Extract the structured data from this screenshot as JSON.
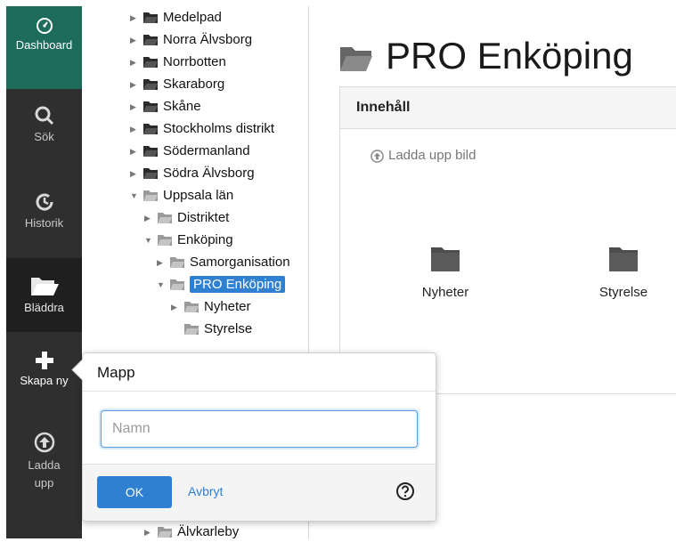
{
  "sidebar": {
    "items": [
      {
        "label": "Dashboard",
        "icon": "dashboard-gauge-icon"
      },
      {
        "label": "Sök",
        "icon": "search-icon"
      },
      {
        "label": "Historik",
        "icon": "history-icon"
      },
      {
        "label": "Bläddra",
        "icon": "folder-open-icon"
      },
      {
        "label": "Skapa ny",
        "icon": "plus-icon"
      },
      {
        "label": "Ladda upp",
        "icon": "upload-icon"
      }
    ]
  },
  "tree": {
    "nodes": [
      {
        "label": "Medelpad"
      },
      {
        "label": "Norra Älvsborg"
      },
      {
        "label": "Norrbotten"
      },
      {
        "label": "Skaraborg"
      },
      {
        "label": "Skåne"
      },
      {
        "label": "Stockholms distrikt"
      },
      {
        "label": "Södermanland"
      },
      {
        "label": "Södra Älvsborg"
      },
      {
        "label": "Uppsala län"
      },
      {
        "label": "Distriktet"
      },
      {
        "label": "Enköping"
      },
      {
        "label": "Samorganisation"
      },
      {
        "label": "PRO Enköping"
      },
      {
        "label": "Nyheter"
      },
      {
        "label": "Styrelse"
      },
      {
        "label": "Älvkarleby"
      }
    ]
  },
  "main": {
    "title": "PRO Enköping",
    "panel_title": "Innehåll",
    "upload_label": "Ladda upp bild",
    "items": [
      {
        "label": "Nyheter"
      },
      {
        "label": "Styrelse"
      }
    ]
  },
  "popover": {
    "title": "Mapp",
    "input_placeholder": "Namn",
    "input_value": "",
    "ok_label": "OK",
    "cancel_label": "Avbryt"
  },
  "colors": {
    "sidebar_bg": "#2f2f2f",
    "active_nav_bg": "#1d6b5a",
    "accent_blue": "#2f80d1"
  }
}
